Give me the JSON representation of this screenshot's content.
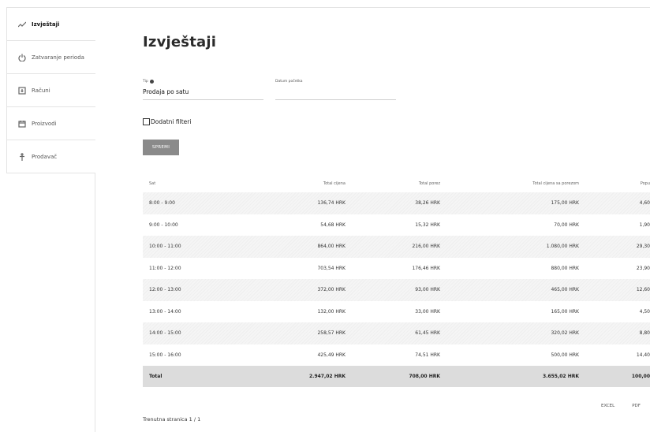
{
  "sidebar": {
    "items": [
      {
        "label": "Izvještaji",
        "icon": "trend-line-icon",
        "active": true
      },
      {
        "label": "Zatvaranje perioda",
        "icon": "power-icon",
        "active": false
      },
      {
        "label": "Računi",
        "icon": "receipt-icon",
        "active": false
      },
      {
        "label": "Proizvodi",
        "icon": "box-icon",
        "active": false
      },
      {
        "label": "Prodavač",
        "icon": "person-icon",
        "active": false
      }
    ]
  },
  "page": {
    "title": "Izvještaji"
  },
  "form": {
    "type_label": "Tip",
    "type_value": "Prodaja po satu",
    "date_label": "Datum početka",
    "date_value": "",
    "filters_label": "Dodatni filteri",
    "save_label": "SPREMI"
  },
  "table": {
    "headers": [
      "Sat",
      "Total cijena",
      "Total porez",
      "Total cijena sa porezom",
      "Popu"
    ],
    "rows": [
      [
        "8:00 - 9:00",
        "136,74 HRK",
        "38,26 HRK",
        "175,00 HRK",
        "4,60"
      ],
      [
        "9:00 - 10:00",
        "54,68 HRK",
        "15,32 HRK",
        "70,00 HRK",
        "1,90"
      ],
      [
        "10:00 - 11:00",
        "864,00 HRK",
        "216,00 HRK",
        "1.080,00 HRK",
        "29,30"
      ],
      [
        "11:00 - 12:00",
        "703,54 HRK",
        "176,46 HRK",
        "880,00 HRK",
        "23,90"
      ],
      [
        "12:00 - 13:00",
        "372,00 HRK",
        "93,00 HRK",
        "465,00 HRK",
        "12,60"
      ],
      [
        "13:00 - 14:00",
        "132,00 HRK",
        "33,00 HRK",
        "165,00 HRK",
        "4,50"
      ],
      [
        "14:00 - 15:00",
        "258,57 HRK",
        "61,45 HRK",
        "320,02 HRK",
        "8,80"
      ],
      [
        "15:00 - 16:00",
        "425,49 HRK",
        "74,51 HRK",
        "500,00 HRK",
        "14,40"
      ]
    ],
    "total": [
      "Total",
      "2.947,02 HRK",
      "708,00 HRK",
      "3.655,02 HRK",
      "100,00"
    ]
  },
  "export": {
    "excel": "EXCEL",
    "pdf": "PDF"
  },
  "pager": {
    "text": "Trenutna stranica 1 / 1"
  }
}
